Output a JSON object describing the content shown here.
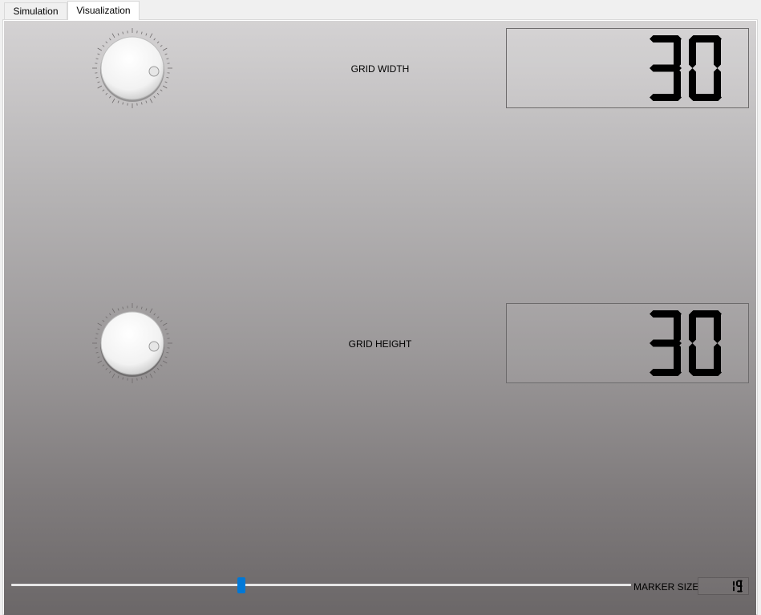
{
  "tabs": [
    {
      "label": "Simulation",
      "active": false
    },
    {
      "label": "Visualization",
      "active": true
    }
  ],
  "controls": {
    "grid_width": {
      "label": "GRID WIDTH",
      "value": "30"
    },
    "grid_height": {
      "label": "GRID HEIGHT",
      "value": "30"
    },
    "marker_size": {
      "label": "MARKER SIZE",
      "value": "19",
      "slider_fraction": 0.37
    }
  },
  "colors": {
    "accent": "#0078d7",
    "lcd_digit": "#000000",
    "background_top": "#d4d2d3",
    "background_bottom": "#6b6768"
  },
  "icons": {
    "knob": "rotary-knob-icon"
  }
}
